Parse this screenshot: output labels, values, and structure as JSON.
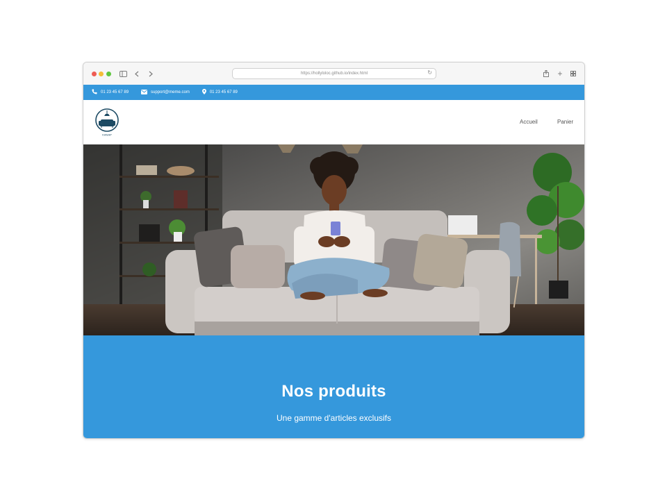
{
  "browser": {
    "url": "https://hollyloloc.github.io/index.html"
  },
  "topbar": {
    "phone": "01 23 45 67 89",
    "email": "support@meme.com",
    "location": "01 23 45 67 89"
  },
  "nav": {
    "logo_text": "KANAP",
    "items": [
      {
        "label": "Accueil"
      },
      {
        "label": "Panier"
      }
    ]
  },
  "products_section": {
    "title": "Nos produits",
    "subtitle": "Une gamme d'articles exclusifs"
  },
  "colors": {
    "brand_blue": "#3598dc",
    "window_chrome": "#f6f6f6",
    "logo_navy": "#1c4a63"
  },
  "icons": [
    "sidebar-icon",
    "back-icon",
    "forward-icon",
    "reload-icon",
    "share-icon",
    "new-tab-icon",
    "tabs-overview-icon",
    "phone-icon",
    "mail-icon",
    "location-icon"
  ]
}
